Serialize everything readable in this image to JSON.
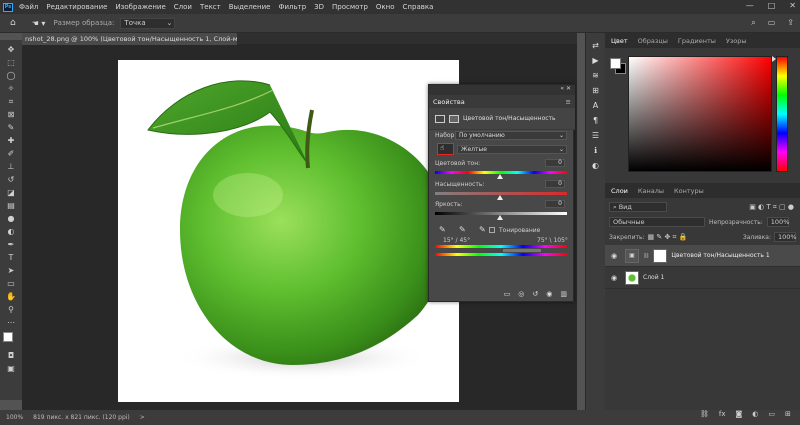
{
  "menubar": {
    "items": [
      "Файл",
      "Редактирование",
      "Изображение",
      "Слои",
      "Текст",
      "Выделение",
      "Фильтр",
      "3D",
      "Просмотр",
      "Окно",
      "Справка"
    ],
    "window_controls": [
      "—",
      "□",
      "✕"
    ]
  },
  "options": {
    "sample_label": "Размер образца:",
    "sample_value": "Точка"
  },
  "document": {
    "tab_title": "nshot_28.png @ 100% (Цветовой тон/Насыщенность 1, Слой-маска/8) *",
    "tab_close": "×"
  },
  "status": {
    "zoom": "100%",
    "size": "819 пикс. x 821 пикс. (120 ppi)",
    "arrow": ">"
  },
  "properties": {
    "tab": "Свойства",
    "adjustment_name": "Цветовой тон/Насыщенность",
    "preset_label": "Набор:",
    "preset_value": "По умолчанию",
    "channel_value": "Желтые",
    "hue_label": "Цветовой тон:",
    "hue_value": "0",
    "saturation_label": "Насыщенность:",
    "saturation_value": "0",
    "lightness_label": "Яркость:",
    "lightness_value": "0",
    "colorize_label": "Тонирование",
    "range_left": "15° / 45°",
    "range_right": "75° \\ 105°"
  },
  "color_panel": {
    "tabs": [
      "Цвет",
      "Образцы",
      "Градиенты",
      "Узоры"
    ]
  },
  "layers_panel": {
    "tabs": [
      "Слои",
      "Каналы",
      "Контуры"
    ],
    "filter_value": "Вид",
    "blend_mode": "Обычные",
    "opacity_label": "Непрозрачность:",
    "opacity_value": "100%",
    "lock_label": "Закрепить:",
    "fill_label": "Заливка:",
    "fill_value": "100%",
    "layers": [
      {
        "name": "Цветовой тон/Насыщенность 1"
      },
      {
        "name": "Слой 1"
      }
    ],
    "bottom_icons": [
      "link-icon",
      "fx-icon",
      "mask-icon",
      "adjustment-icon",
      "group-icon",
      "new-layer-icon",
      "trash-icon"
    ]
  },
  "colors": {
    "accent": "#31a8ff",
    "highlight": "#e22222",
    "apple": "#5fbf2f"
  }
}
